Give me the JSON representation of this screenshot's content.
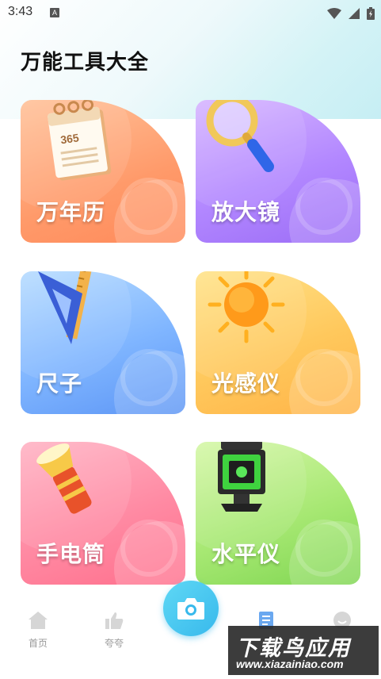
{
  "status": {
    "time": "3:43",
    "notification_icon": "A"
  },
  "page": {
    "title": "万能工具大全"
  },
  "tools": [
    {
      "label": "万年历",
      "icon": "calendar-icon",
      "calendar_text": "365",
      "color": "#ff9a6a"
    },
    {
      "label": "放大镜",
      "icon": "magnifier-icon",
      "color": "#b287ff"
    },
    {
      "label": "尺子",
      "icon": "ruler-icon",
      "color": "#7fb5ff"
    },
    {
      "label": "光感仪",
      "icon": "sun-icon",
      "color": "#ffc85c"
    },
    {
      "label": "手电筒",
      "icon": "flashlight-icon",
      "color": "#ff8aa3"
    },
    {
      "label": "水平仪",
      "icon": "laser-level-icon",
      "color": "#a7e873"
    }
  ],
  "nav": {
    "home_label": "首页",
    "praise_label": "夸夸",
    "camera_icon": "camera-icon"
  },
  "watermark": {
    "main": "下载鸟应用",
    "url": "www.xiazainiao.com"
  }
}
